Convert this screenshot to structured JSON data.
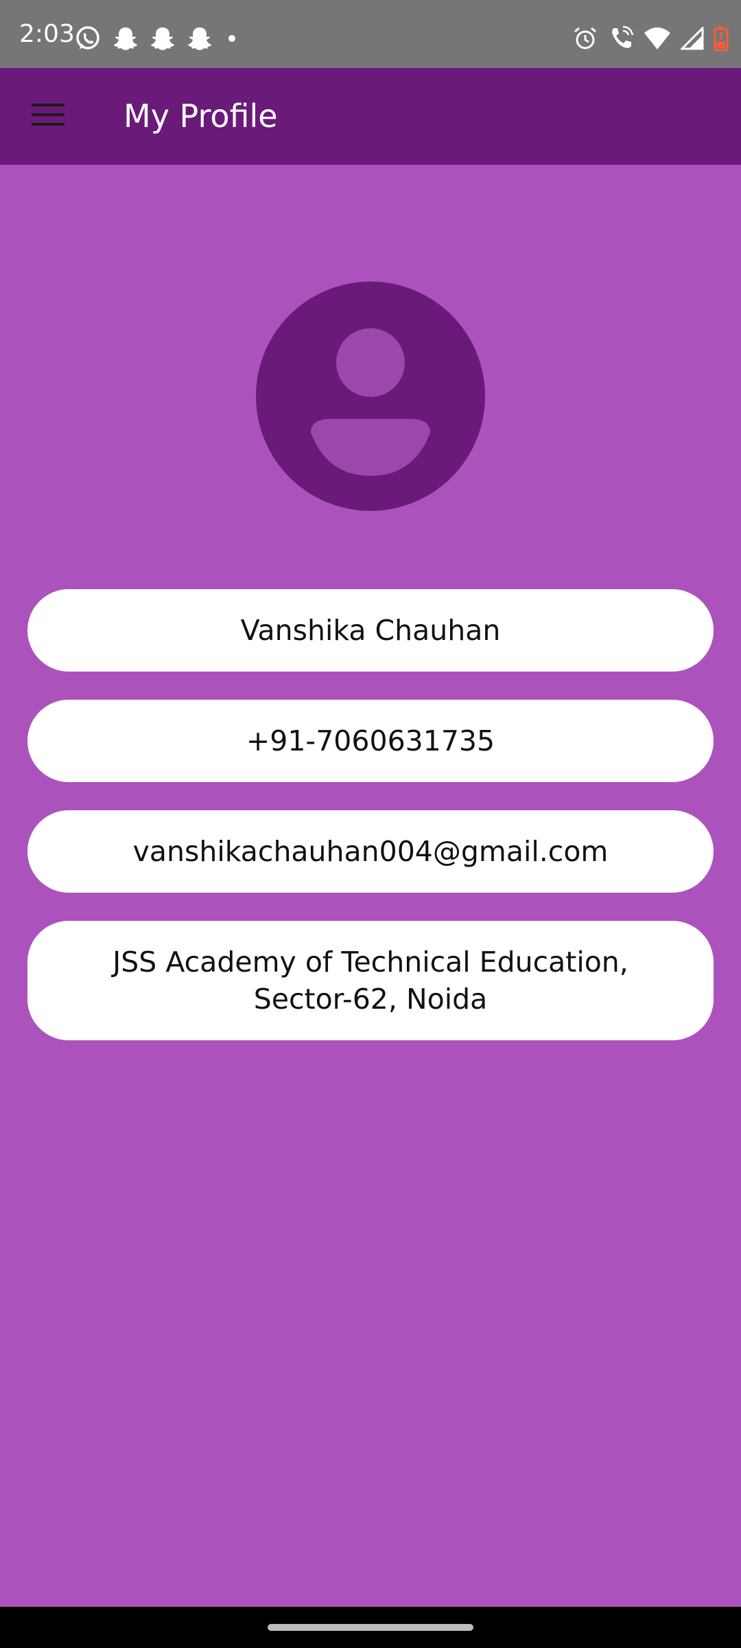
{
  "status_bar": {
    "time": "2:03",
    "left_icons": [
      "whatsapp-icon",
      "snapchat-icon",
      "snapchat-icon",
      "snapchat-icon",
      "dot-icon"
    ],
    "right_icons": [
      "alarm-icon",
      "wifi-call-icon",
      "wifi-icon",
      "signal-icon",
      "battery-low-icon"
    ],
    "background": "#767676"
  },
  "app_bar": {
    "title": "My Profile",
    "menu_icon": "hamburger-menu-icon",
    "background": "#6a1a79"
  },
  "profile": {
    "avatar_icon": "person-icon",
    "name": "Vanshika Chauhan",
    "phone": "+91-7060631735",
    "email": "vanshikachauhan004@gmail.com",
    "address": "JSS Academy of Technical Education,\nSector-62, Noida"
  },
  "colors": {
    "page_background": "#ac52bd",
    "card_background": "#ffffff",
    "avatar_circle": "#6a1a79",
    "avatar_figure": "#9a48aa"
  }
}
